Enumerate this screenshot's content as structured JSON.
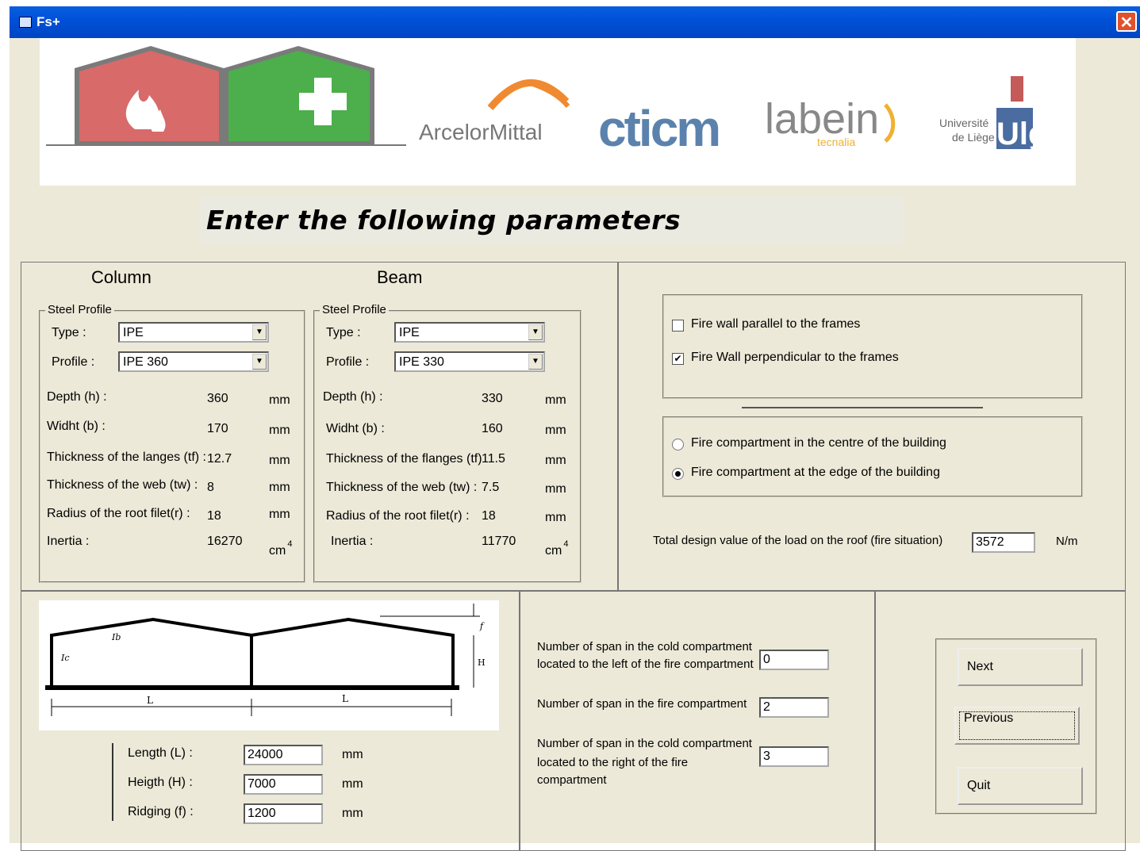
{
  "window": {
    "title": "Fs+"
  },
  "banner": {
    "logos": [
      "ArcelorMittal",
      "cticm",
      "labein",
      "tecnalia",
      "Université",
      "de Liège",
      "Ulg"
    ]
  },
  "heading": "Enter the following parameters",
  "column": {
    "title": "Column",
    "group": "Steel Profile",
    "type_label": "Type :",
    "type_value": "IPE",
    "profile_label": "Profile :",
    "profile_value": "IPE 360",
    "rows": [
      {
        "label": "Depth (h) :",
        "value": "360",
        "unit": "mm"
      },
      {
        "label": "Widht (b) :",
        "value": "170",
        "unit": "mm"
      },
      {
        "label": "Thickness of the langes (tf) :",
        "value": "12.7",
        "unit": "mm"
      },
      {
        "label": "Thickness of the web (tw) :",
        "value": "8",
        "unit": "mm"
      },
      {
        "label": "Radius of the root filet(r) :",
        "value": "18",
        "unit": "mm"
      },
      {
        "label": "Inertia :",
        "value": "16270",
        "unit": "cm",
        "exp": "4"
      }
    ]
  },
  "beam": {
    "title": "Beam",
    "group": "Steel Profile",
    "type_label": "Type :",
    "type_value": "IPE",
    "profile_label": "Profile :",
    "profile_value": "IPE 330",
    "rows": [
      {
        "label": "Depth (h) :",
        "value": "330",
        "unit": "mm"
      },
      {
        "label": "Widht (b) :",
        "value": "160",
        "unit": "mm"
      },
      {
        "label": "Thickness of the flanges (tf)",
        "value": "11.5",
        "unit": "mm"
      },
      {
        "label": "Thickness of the web (tw) :",
        "value": "7.5",
        "unit": "mm"
      },
      {
        "label": "Radius of the root filet(r) :",
        "value": "18",
        "unit": "mm"
      },
      {
        "label": "Inertia :",
        "value": "11770",
        "unit": "cm",
        "exp": "4"
      }
    ]
  },
  "firewall": {
    "parallel_label": "Fire wall parallel to the frames",
    "parallel_checked": false,
    "perpendicular_label": "Fire Wall perpendicular to the frames",
    "perpendicular_checked": true
  },
  "compartment": {
    "centre_label": "Fire compartment in the centre of the building",
    "centre_selected": false,
    "edge_label": "Fire compartment at the edge of the building",
    "edge_selected": true
  },
  "load": {
    "label": "Total design value of the load on the roof (fire situation)",
    "value": "3572",
    "unit": "N/m"
  },
  "diagram": {
    "ic_label": "Ic",
    "ib_label": "Ib",
    "l_label": "L",
    "h_label": "H",
    "f_label": "f"
  },
  "geometry": {
    "length_label": "Length (L) :",
    "length_value": "24000",
    "length_unit": "mm",
    "height_label": "Heigth (H) :",
    "height_value": "7000",
    "height_unit": "mm",
    "ridging_label": "Ridging (f) :",
    "ridging_value": "1200",
    "ridging_unit": "mm"
  },
  "spans": {
    "left_label_1": "Number of span in the cold compartment",
    "left_label_2": "located to the left of the fire compartment",
    "left_value": "0",
    "fire_label": "Number of span in the fire compartment",
    "fire_value": "2",
    "right_label_1": "Number of span in the cold compartment",
    "right_label_2": "located to the right of the fire",
    "right_label_3": "compartment",
    "right_value": "3"
  },
  "buttons": {
    "next": "Next",
    "previous": "Previous",
    "quit": "Quit"
  },
  "colors": {
    "titlebar": "#0051d8",
    "window_bg": "#ece9d8",
    "fire_red": "#d86a6a",
    "green": "#4caf4c",
    "arcelor_orange": "#f08a30",
    "cticm_blue": "#5b82ad"
  }
}
